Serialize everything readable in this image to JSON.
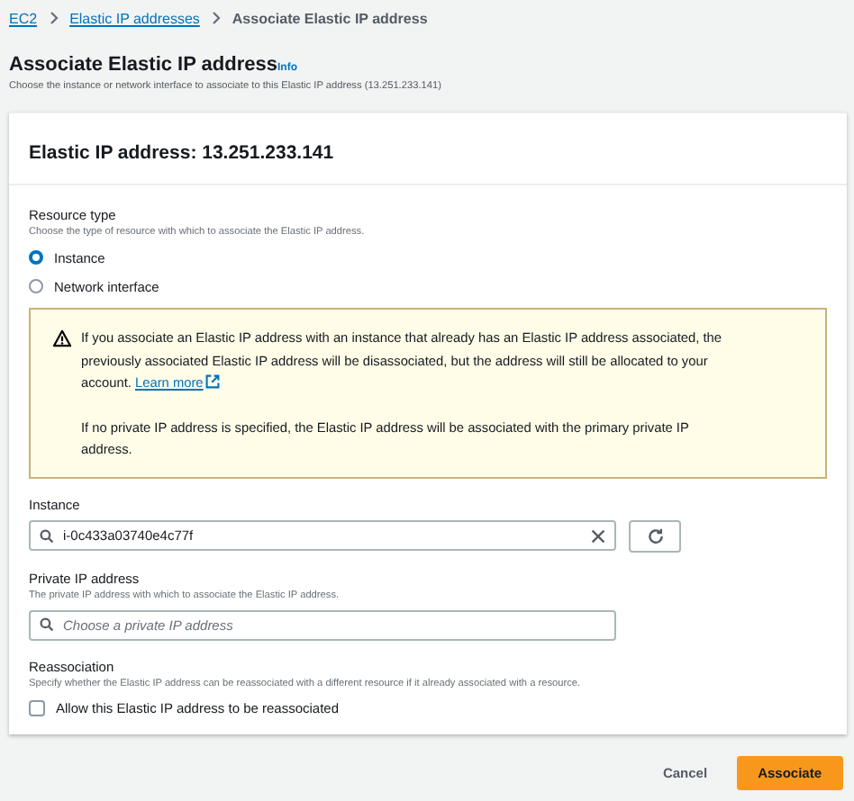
{
  "breadcrumbs": [
    {
      "label": "EC2",
      "link": true
    },
    {
      "label": "Elastic IP addresses",
      "link": true
    },
    {
      "label": "Associate Elastic IP address",
      "link": false
    }
  ],
  "header": {
    "title": "Associate Elastic IP address",
    "info": "Info",
    "description": "Choose the instance or network interface to associate to this Elastic IP address (13.251.233.141)"
  },
  "card": {
    "title": "Elastic IP address: 13.251.233.141"
  },
  "resource_type": {
    "label": "Resource type",
    "description": "Choose the type of resource with which to associate the Elastic IP address.",
    "options": [
      {
        "label": "Instance",
        "selected": true
      },
      {
        "label": "Network interface",
        "selected": false
      }
    ]
  },
  "warning": {
    "text": "If you associate an Elastic IP address with an instance that already has an Elastic IP address associated, the previously associated Elastic IP address will be disassociated, but the address will still be allocated to your account.",
    "link": "Learn more",
    "note": "If no private IP address is specified, the Elastic IP address will be associated with the primary private IP address."
  },
  "instance": {
    "label": "Instance",
    "value": "i-0c433a03740e4c77f"
  },
  "private_ip": {
    "label": "Private IP address",
    "description": "The private IP address with which to associate the Elastic IP address.",
    "placeholder": "Choose a private IP address"
  },
  "reassociation": {
    "label": "Reassociation",
    "description": "Specify whether the Elastic IP address can be reassociated with a different resource if it already associated with a resource.",
    "checkbox": {
      "label": "Allow this Elastic IP address to be reassociated",
      "checked": false
    }
  },
  "buttons": [
    {
      "label": "Cancel",
      "kind": "link"
    },
    {
      "label": "Associate",
      "kind": "primary"
    }
  ]
}
